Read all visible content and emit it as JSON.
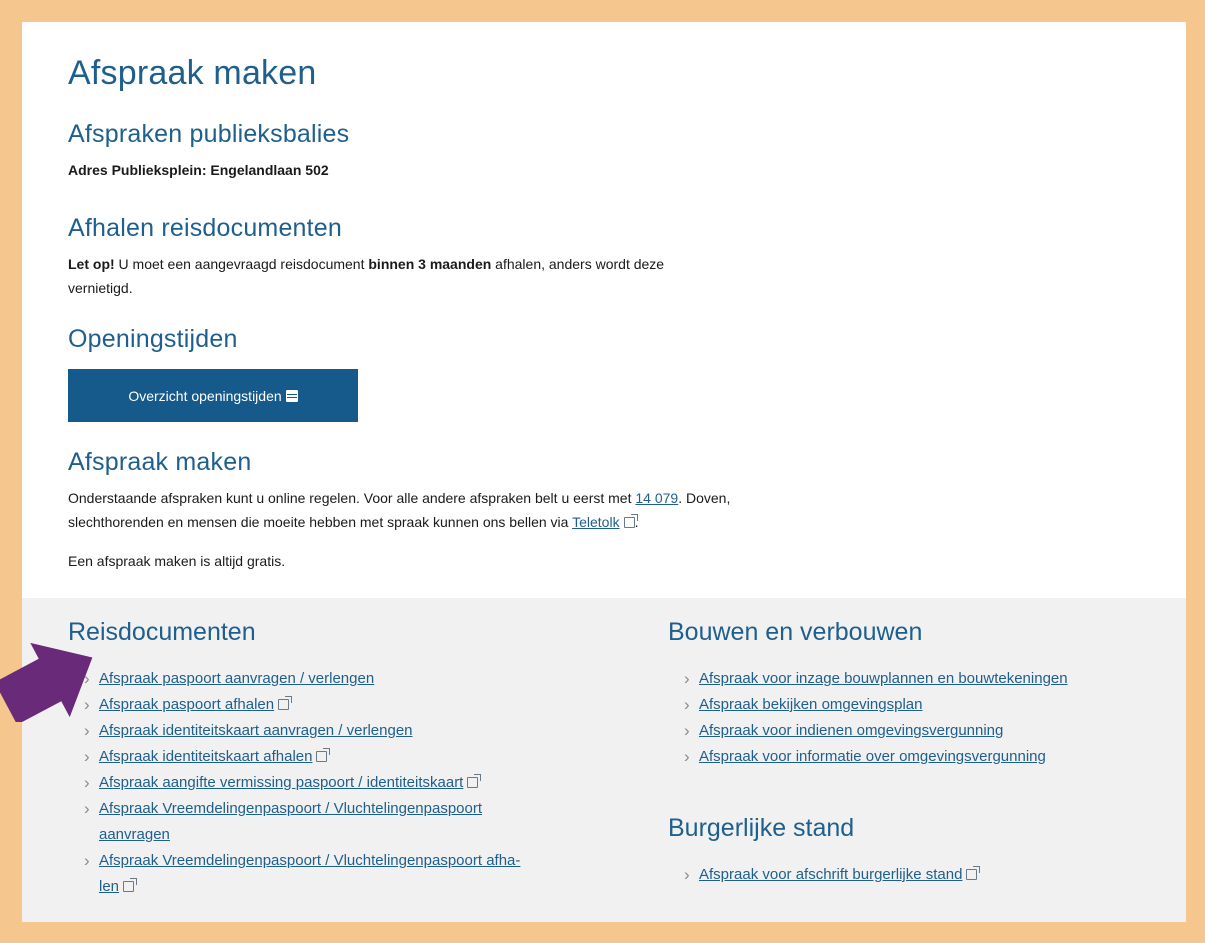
{
  "page": {
    "title": "Afspraak maken"
  },
  "publieksbalies": {
    "heading": "Afspraken publieksbalies",
    "address": "Adres Publieksplein: Engelandlaan 502"
  },
  "reisdocumenten_afhalen": {
    "heading": "Afhalen reisdocumenten",
    "note_bold": "Let op!",
    "note_text1": " U moet een aangevraagd reisdocument ",
    "note_bold2": "binnen 3 maanden",
    "note_text2": " afhalen, anders wordt deze",
    "note_text3": "vernietigd."
  },
  "openingstijden": {
    "heading": "Openingstijden",
    "button_label": "Overzicht openingstijden"
  },
  "afspraak_maken": {
    "heading": "Afspraak maken",
    "text1": "Onderstaande afspraken kunt u online regelen. Voor alle andere afspraken belt u eerst met ",
    "phone_link": "14 079",
    "text2": ". Doven,",
    "text3": "slechthorenden en mensen die moeite hebben met spraak kunnen ons bellen via ",
    "teletolk_link": "Teletolk",
    "text4": ".",
    "free_text": "Een afspraak maken is altijd gratis."
  },
  "reisdocumenten": {
    "heading": "Reisdocumenten",
    "items": [
      {
        "label": "Afspraak paspoort aanvragen / verlengen",
        "external": false
      },
      {
        "label": "Afspraak paspoort afhalen",
        "external": true
      },
      {
        "label": "Afspraak identiteitskaart aanvragen / verlengen",
        "external": false
      },
      {
        "label": "Afspraak identiteitskaart afhalen",
        "external": true
      },
      {
        "label": "Afspraak aangifte vermissing paspoort / identiteitskaart",
        "external": true
      },
      {
        "label": "Afspraak Vreemdelingenpaspoort / Vluchtelingenpaspoort",
        "label2": "aanvragen",
        "external": false
      },
      {
        "label": "Afspraak Vreemdelingenpaspoort / Vluchtelingenpaspoort afha-",
        "label2": "len",
        "external": true
      }
    ]
  },
  "bouwen": {
    "heading": "Bouwen en verbouwen",
    "items": [
      {
        "label": "Afspraak voor inzage bouwplannen en bouwtekeningen",
        "external": false
      },
      {
        "label": "Afspraak bekijken omgevingsplan",
        "external": false
      },
      {
        "label": "Afspraak voor indienen omgevingsvergunning",
        "external": false
      },
      {
        "label": "Afspraak voor informatie over omgevingsvergunning",
        "external": false
      }
    ]
  },
  "burgerlijke_stand": {
    "heading": "Burgerlijke stand",
    "items": [
      {
        "label": "Afspraak voor afschrift burgerlijke stand",
        "external": true
      }
    ]
  },
  "colors": {
    "frame": "#f5c78e",
    "heading_blue": "#1f5f8d",
    "button_blue": "#155a8a",
    "arrow_purple": "#6a2a7a",
    "grey_panel": "#f1f1f1"
  },
  "icons": {
    "button_icon": "calendar-icon",
    "external_icon": "external-link-icon",
    "annotation": "arrow-pointer-icon"
  }
}
